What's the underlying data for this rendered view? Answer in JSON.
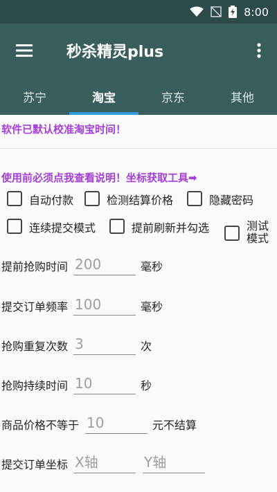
{
  "status": {
    "time": "8:00"
  },
  "appbar": {
    "title": "秒杀精灵plus"
  },
  "tabs": [
    {
      "label": "苏宁"
    },
    {
      "label": "淘宝"
    },
    {
      "label": "京东"
    },
    {
      "label": "其他"
    }
  ],
  "notice": "软件已默认校准淘宝时间！",
  "help": "使用前必须点我查看说明！坐标获取工具➡",
  "checkboxes": {
    "auto_pay": "自动付款",
    "check_price": "检测结算价格",
    "hide_password": "隐藏密码",
    "continuous_submit": "连续提交模式",
    "pre_refresh": "提前刷新并勾选",
    "test_mode": "测试模式"
  },
  "settings": {
    "advance_time": {
      "label": "提前抢购时间",
      "value": "200",
      "unit": "毫秒"
    },
    "submit_freq": {
      "label": "提交订单频率",
      "value": "100",
      "unit": "毫秒"
    },
    "repeat_count": {
      "label": "抢购重复次数",
      "value": "3",
      "unit": "次"
    },
    "duration": {
      "label": "抢购持续时间",
      "value": "10",
      "unit": "秒"
    },
    "price_check": {
      "label": "商品价格不等于",
      "value": "10",
      "unit": "元不结算"
    },
    "coords": {
      "label": "提交订单坐标",
      "x_placeholder": "X轴",
      "y_placeholder": "Y轴"
    }
  },
  "colors": {
    "appbar": "#395e5c",
    "statusbar": "#2c4a4a",
    "accent": "#2f9ad8",
    "link": "#a43fd8"
  }
}
